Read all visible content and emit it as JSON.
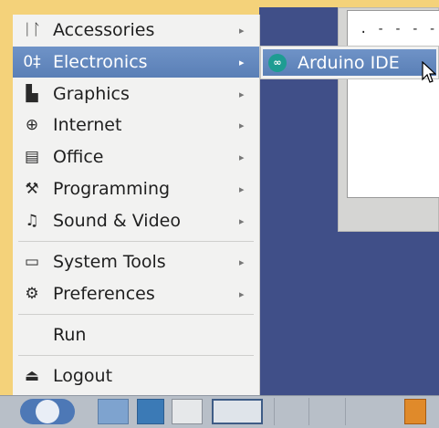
{
  "menu": {
    "items": [
      {
        "label": "Accessories",
        "icon": "accessories-icon",
        "glyph": "ᛁᛚ"
      },
      {
        "label": "Electronics",
        "icon": "electronics-icon",
        "glyph": "0‡"
      },
      {
        "label": "Graphics",
        "icon": "graphics-icon",
        "glyph": "▙"
      },
      {
        "label": "Internet",
        "icon": "globe-icon",
        "glyph": "⊕"
      },
      {
        "label": "Office",
        "icon": "document-icon",
        "glyph": "▤"
      },
      {
        "label": "Programming",
        "icon": "programming-icon",
        "glyph": "⚒"
      },
      {
        "label": "Sound & Video",
        "icon": "sound-video-icon",
        "glyph": "♫"
      },
      {
        "label": "System Tools",
        "icon": "monitor-icon",
        "glyph": "▭"
      },
      {
        "label": "Preferences",
        "icon": "gear-icon",
        "glyph": "⚙"
      },
      {
        "label": "Run"
      },
      {
        "label": "Logout",
        "icon": "logout-icon",
        "glyph": "⏏"
      }
    ],
    "submenu_arrow": "▸"
  },
  "submenu": {
    "items": [
      {
        "label": "Arduino IDE",
        "icon": "arduino-icon",
        "glyph": "∞"
      }
    ]
  },
  "background_window": {
    "text": ". - - - -"
  },
  "colors": {
    "menu_highlight": "#6386bd",
    "desktop": "#404f88",
    "top_strip": "#f4d27a",
    "taskbar": "#b8bfc8"
  }
}
